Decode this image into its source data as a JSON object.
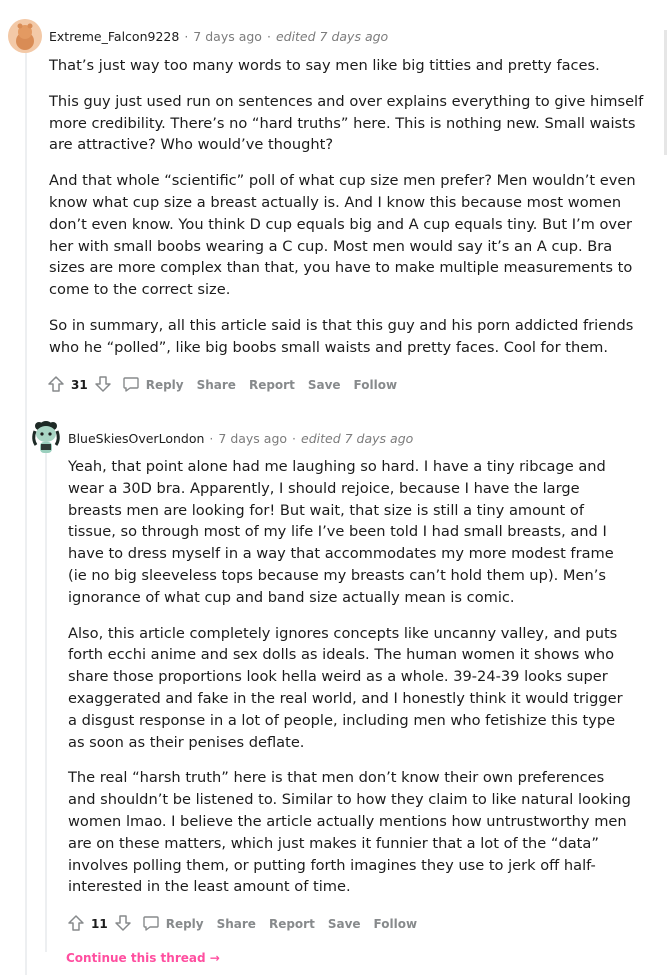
{
  "comment1": {
    "author": "Extreme_Falcon9228",
    "time": "7 days ago",
    "edited": "edited 7 days ago",
    "paragraphs": [
      "That’s just way too many words to say men like big titties and pretty faces.",
      "This guy just used run on sentences and over explains everything to give himself more credibility. There’s no “hard truths” here. This is nothing new. Small waists are attractive? Who would’ve thought?",
      "And that whole “scientific” poll of what cup size men prefer? Men wouldn’t even know what cup size a breast actually is. And I know this because most women don’t even know. You think D cup equals big and A cup equals tiny. But I’m over her with small boobs wearing a C cup. Most men would say it’s an A cup. Bra sizes are more complex than that, you have to make multiple measurements to come to the correct size.",
      "So in summary, all this article said is that this guy and his porn addicted friends who he “polled”, like big boobs small waists and pretty faces. Cool for them."
    ],
    "score": "31",
    "actions": {
      "reply": "Reply",
      "share": "Share",
      "report": "Report",
      "save": "Save",
      "follow": "Follow"
    }
  },
  "comment2": {
    "author": "BlueSkiesOverLondon",
    "time": "7 days ago",
    "edited": "edited 7 days ago",
    "paragraphs": [
      "Yeah, that point alone had me laughing so hard. I have a tiny ribcage and wear a 30D bra. Apparently, I should rejoice, because I have the large breasts men are looking for! But wait, that size is still a tiny amount of tissue, so through most of my life I’ve been told I had small breasts, and I have to dress myself in a way that accommodates my more modest frame (ie no big sleeveless tops because my breasts can’t hold them up). Men’s ignorance of what cup and band size actually mean is comic.",
      "Also, this article completely ignores concepts like uncanny valley, and puts forth ecchi anime and sex dolls as ideals. The human women it shows who share those proportions look hella weird as a whole. 39-24-39 looks super exaggerated and fake in the real world, and I honestly think it would trigger a disgust response in a lot of people, including men who fetishize this type as soon as their penises deflate.",
      "The real “harsh truth” here is that men don’t know their own preferences and shouldn’t be listened to. Similar to how they claim to like natural looking women lmao. I believe the article actually mentions how untrustworthy men are on these matters, which just makes it funnier that a lot of the “data” involves polling them, or putting forth imagines they use to jerk off half-interested in the least amount of time."
    ],
    "score": "11",
    "actions": {
      "reply": "Reply",
      "share": "Share",
      "report": "Report",
      "save": "Save",
      "follow": "Follow"
    }
  },
  "continue_thread": "Continue this thread →",
  "colors": {
    "accent_link": "#ff4fa0",
    "muted": "#878a8c",
    "thread_line": "#edeff1"
  }
}
